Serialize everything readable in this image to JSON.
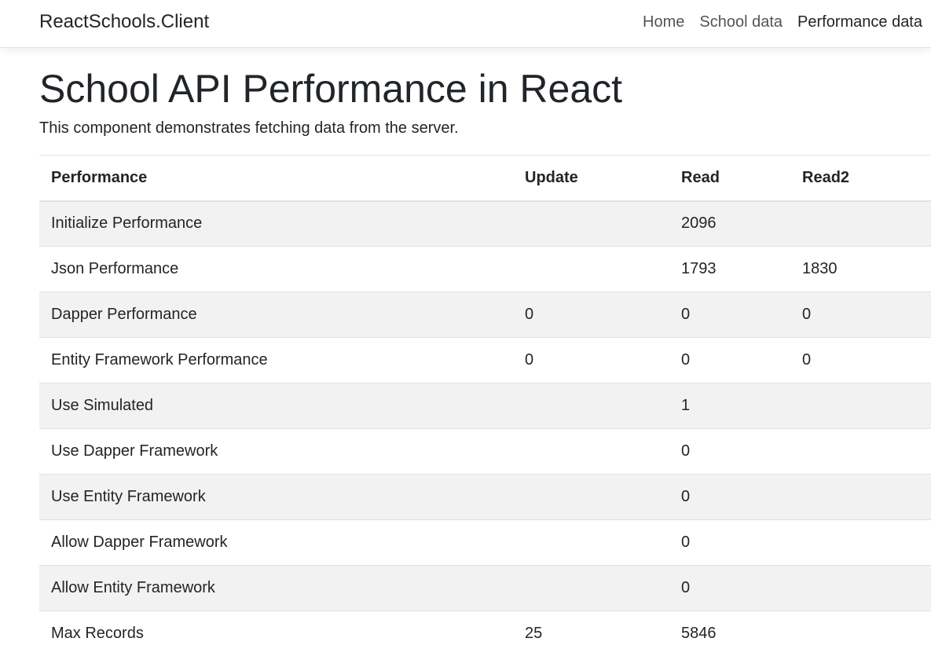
{
  "nav": {
    "brand": "ReactSchools.Client",
    "links": [
      "Home",
      "School data",
      "Performance data"
    ]
  },
  "page": {
    "title": "School API Performance in React",
    "lead": "This component demonstrates fetching data from the server."
  },
  "table": {
    "headers": [
      "Performance",
      "Update",
      "Read",
      "Read2"
    ],
    "rows": [
      [
        "Initialize Performance",
        "",
        "2096",
        ""
      ],
      [
        "Json Performance",
        "",
        "1793",
        "1830"
      ],
      [
        "Dapper Performance",
        "0",
        "0",
        "0"
      ],
      [
        "Entity Framework Performance",
        "0",
        "0",
        "0"
      ],
      [
        "Use Simulated",
        "",
        "1",
        ""
      ],
      [
        "Use Dapper Framework",
        "",
        "0",
        ""
      ],
      [
        "Use Entity Framework",
        "",
        "0",
        ""
      ],
      [
        "Allow Dapper Framework",
        "",
        "0",
        ""
      ],
      [
        "Allow Entity Framework",
        "",
        "0",
        ""
      ],
      [
        "Max Records",
        "25",
        "5846",
        ""
      ]
    ]
  }
}
